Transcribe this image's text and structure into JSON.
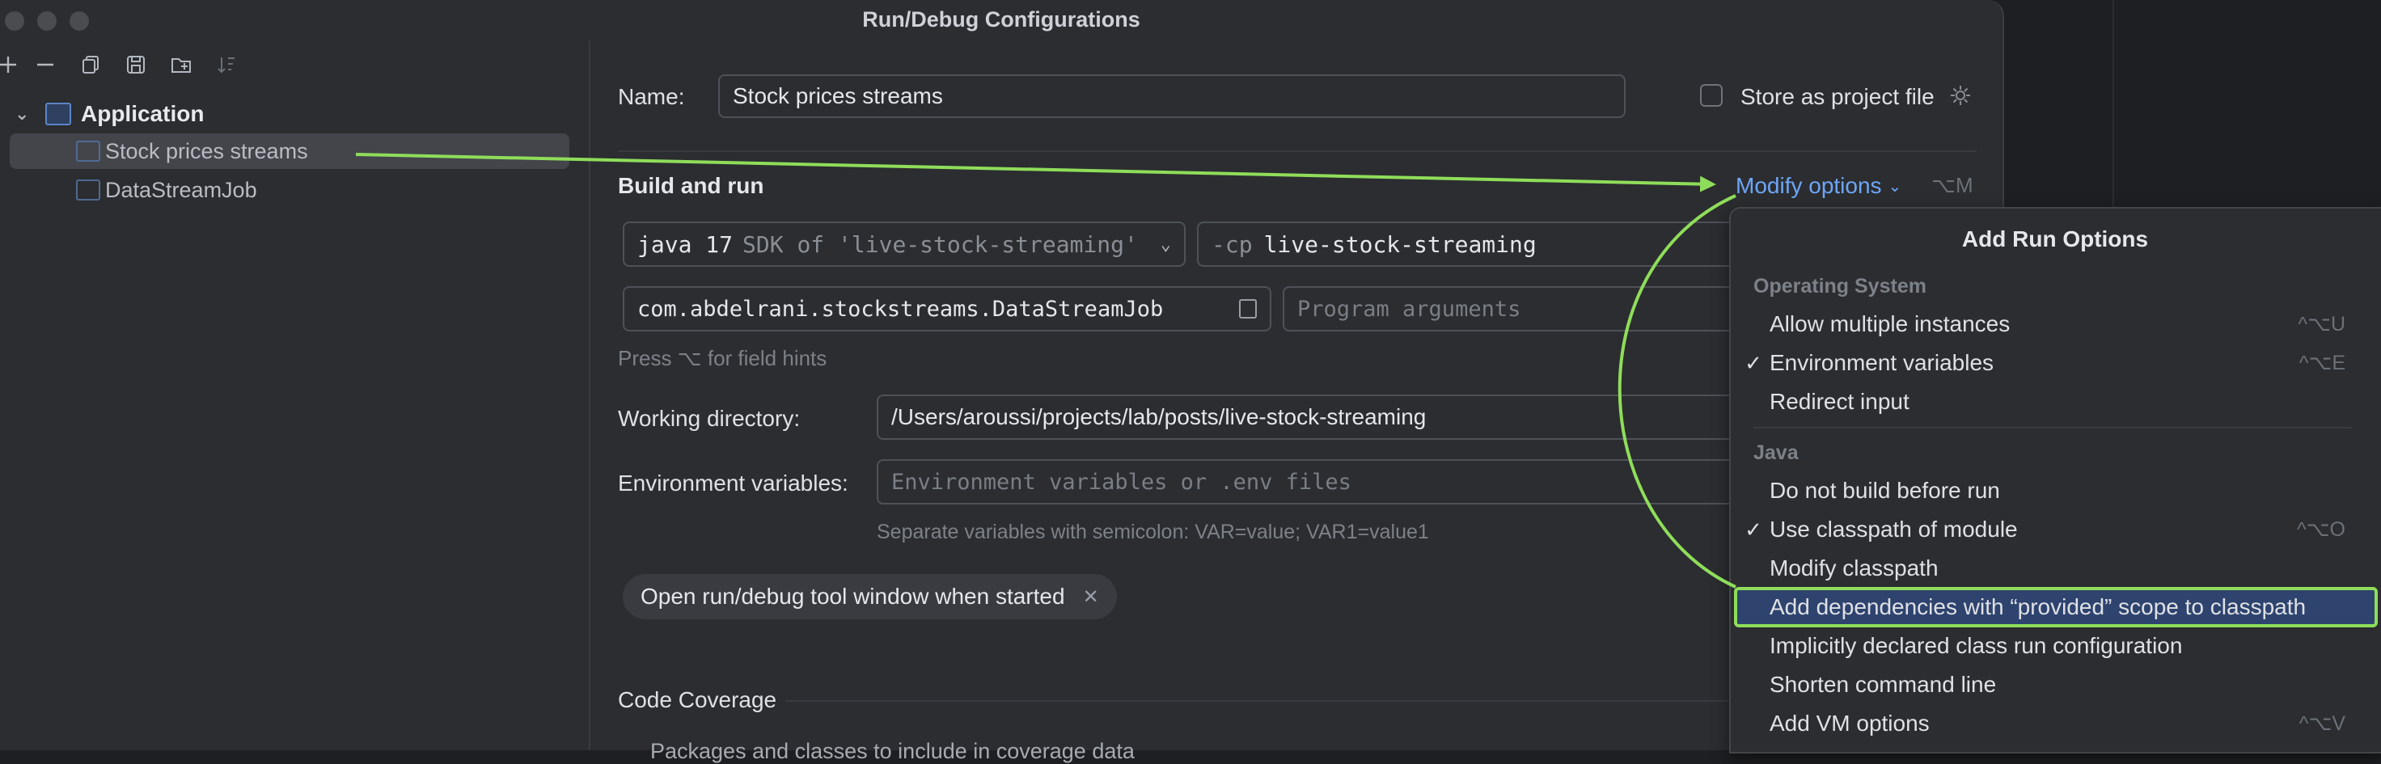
{
  "window": {
    "title": "Run/Debug Configurations"
  },
  "tree": {
    "group": "Application",
    "items": [
      {
        "label": "Stock prices streams"
      },
      {
        "label": "DataStreamJob"
      }
    ]
  },
  "form": {
    "name_label": "Name:",
    "name_value": "Stock prices streams",
    "store_label": "Store as project file",
    "build_title": "Build and run",
    "modify_options": "Modify options",
    "modify_shortcut": "⌥M",
    "sdk_main": "java 17",
    "sdk_detail": "SDK of 'live-stock-streaming'",
    "cp_flag": "-cp",
    "cp_value": "live-stock-streaming",
    "main_class": "com.abdelrani.stockstreams.DataStreamJob",
    "program_args_placeholder": "Program arguments",
    "field_hint": "Press ⌥ for field hints",
    "working_dir_label": "Working directory:",
    "working_dir_value": "/Users/aroussi/projects/lab/posts/live-stock-streaming",
    "env_label": "Environment variables:",
    "env_placeholder": "Environment variables or .env files",
    "env_hint": "Separate variables with semicolon: VAR=value; VAR1=value1",
    "tag_chip": "Open run/debug tool window when started",
    "coverage_title": "Code Coverage",
    "coverage_sub": "Packages and classes to include in coverage data"
  },
  "popup": {
    "title": "Add Run Options",
    "groups": [
      {
        "name": "Operating System",
        "options": [
          {
            "label": "Allow multiple instances",
            "checked": false,
            "shortcut": "^⌥U"
          },
          {
            "label": "Environment variables",
            "checked": true,
            "shortcut": "^⌥E"
          },
          {
            "label": "Redirect input",
            "checked": false,
            "shortcut": ""
          }
        ]
      },
      {
        "name": "Java",
        "options": [
          {
            "label": "Do not build before run",
            "checked": false,
            "shortcut": ""
          },
          {
            "label": "Use classpath of module",
            "checked": true,
            "shortcut": "^⌥O"
          },
          {
            "label": "Modify classpath",
            "checked": false,
            "shortcut": ""
          },
          {
            "label": "Add dependencies with “provided” scope to classpath",
            "checked": false,
            "shortcut": "",
            "selected": true
          },
          {
            "label": "Implicitly declared class run configuration",
            "checked": false,
            "shortcut": ""
          },
          {
            "label": "Shorten command line",
            "checked": false,
            "shortcut": ""
          },
          {
            "label": "Add VM options",
            "checked": false,
            "shortcut": "^⌥V"
          }
        ]
      }
    ],
    "checkmark": "✓"
  },
  "colors": {
    "accent": "#6ea6f7",
    "annotation": "#8fdd5a",
    "selection": "#2e436e"
  }
}
